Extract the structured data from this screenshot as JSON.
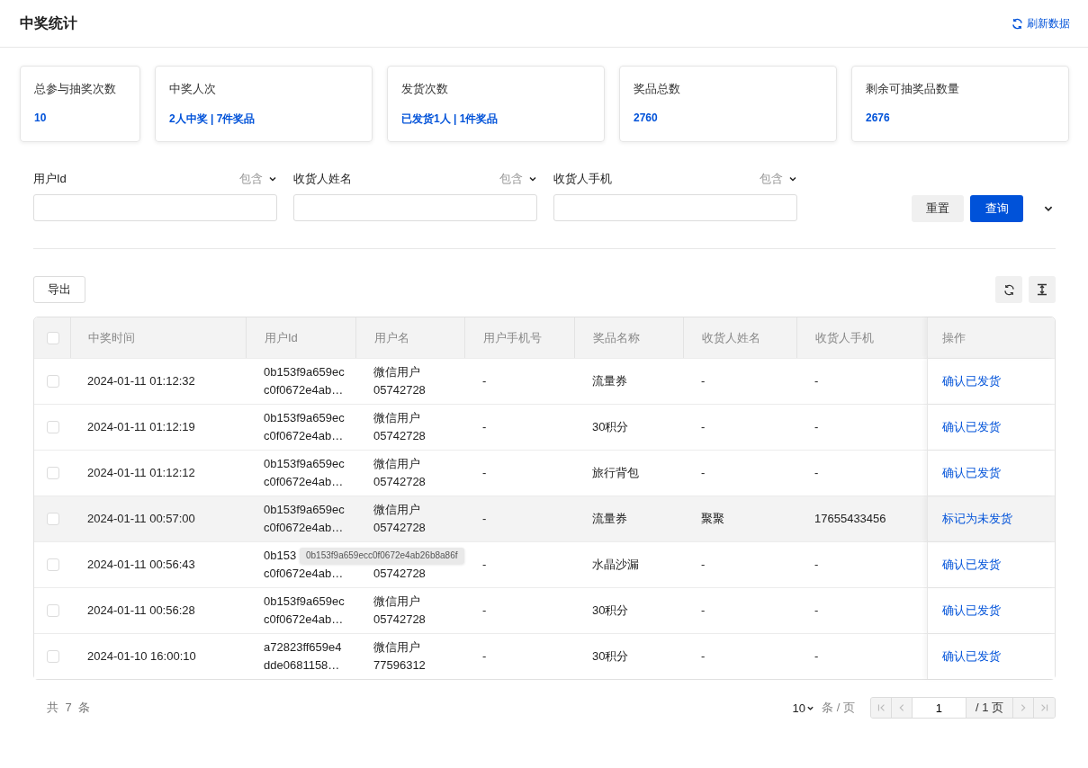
{
  "header": {
    "title": "中奖统计",
    "refresh_label": "刷新数据"
  },
  "stats": [
    {
      "label": "总参与抽奖次数",
      "value": "10"
    },
    {
      "label": "中奖人次",
      "value": "2人中奖 | 7件奖品"
    },
    {
      "label": "发货次数",
      "value": "已发货1人 | 1件奖品"
    },
    {
      "label": "奖品总数",
      "value": "2760"
    },
    {
      "label": "剩余可抽奖品数量",
      "value": "2676"
    }
  ],
  "filters": [
    {
      "label": "用户Id",
      "operator": "包含"
    },
    {
      "label": "收货人姓名",
      "operator": "包含"
    },
    {
      "label": "收货人手机",
      "operator": "包含"
    }
  ],
  "filter_buttons": [
    {
      "label": "重置",
      "kind": "secondary"
    },
    {
      "label": "查询",
      "kind": "primary"
    }
  ],
  "export_label": "导出",
  "table": {
    "header_checked": false,
    "columns": [
      "中奖时间",
      "用户Id",
      "用户名",
      "用户手机号",
      "奖品名称",
      "收货人姓名",
      "收货人手机",
      "操作"
    ],
    "rows": [
      {
        "checked": false,
        "highlighted": false,
        "time": "2024-01-11 01:12:32",
        "user_id": [
          "0b153f9a659ec",
          "c0f0672e4ab…"
        ],
        "user_name": [
          "微信用户",
          "05742728"
        ],
        "user_phone": "-",
        "prize": "流量券",
        "recipient": "-",
        "recipient_phone": "-",
        "action": "确认已发货"
      },
      {
        "checked": false,
        "highlighted": false,
        "time": "2024-01-11 01:12:19",
        "user_id": [
          "0b153f9a659ec",
          "c0f0672e4ab…"
        ],
        "user_name": [
          "微信用户",
          "05742728"
        ],
        "user_phone": "-",
        "prize": "30积分",
        "recipient": "-",
        "recipient_phone": "-",
        "action": "确认已发货"
      },
      {
        "checked": false,
        "highlighted": false,
        "time": "2024-01-11 01:12:12",
        "user_id": [
          "0b153f9a659ec",
          "c0f0672e4ab…"
        ],
        "user_name": [
          "微信用户",
          "05742728"
        ],
        "user_phone": "-",
        "prize": "旅行背包",
        "recipient": "-",
        "recipient_phone": "-",
        "action": "确认已发货"
      },
      {
        "checked": false,
        "highlighted": true,
        "time": "2024-01-11 00:57:00",
        "user_id": [
          "0b153f9a659ec",
          "c0f0672e4ab…"
        ],
        "user_name": [
          "微信用户",
          "05742728"
        ],
        "user_phone": "-",
        "prize": "流量券",
        "recipient": "聚聚",
        "recipient_phone": "17655433456",
        "action": "标记为未发货"
      },
      {
        "checked": false,
        "highlighted": false,
        "time": "2024-01-11 00:56:43",
        "user_id": [
          "0b153",
          "c0f0672e4ab…"
        ],
        "user_name": [
          "05742728"
        ],
        "user_phone": "-",
        "prize": "水晶沙漏",
        "recipient": "-",
        "recipient_phone": "-",
        "action": "确认已发货",
        "tooltip": "0b153f9a659ecc0f0672e4ab26b8a86f"
      },
      {
        "checked": false,
        "highlighted": false,
        "time": "2024-01-11 00:56:28",
        "user_id": [
          "0b153f9a659ec",
          "c0f0672e4ab…"
        ],
        "user_name": [
          "微信用户",
          "05742728"
        ],
        "user_phone": "-",
        "prize": "30积分",
        "recipient": "-",
        "recipient_phone": "-",
        "action": "确认已发货"
      },
      {
        "checked": false,
        "highlighted": false,
        "time": "2024-01-10 16:00:10",
        "user_id": [
          "a72823ff659e4",
          "dde0681158…"
        ],
        "user_name": [
          "微信用户",
          "77596312"
        ],
        "user_phone": "-",
        "prize": "30积分",
        "recipient": "-",
        "recipient_phone": "-",
        "action": "确认已发货"
      }
    ]
  },
  "footer": {
    "total": "共 7 条",
    "page_size": "10",
    "page_size_unit": "条 / 页",
    "page": "1",
    "page_total": "/ 1 页",
    "pager_buttons": [
      {
        "kind": "first",
        "disabled": true
      },
      {
        "kind": "prev",
        "disabled": true
      },
      {
        "kind": "next",
        "disabled": true
      },
      {
        "kind": "last",
        "disabled": true
      }
    ]
  }
}
